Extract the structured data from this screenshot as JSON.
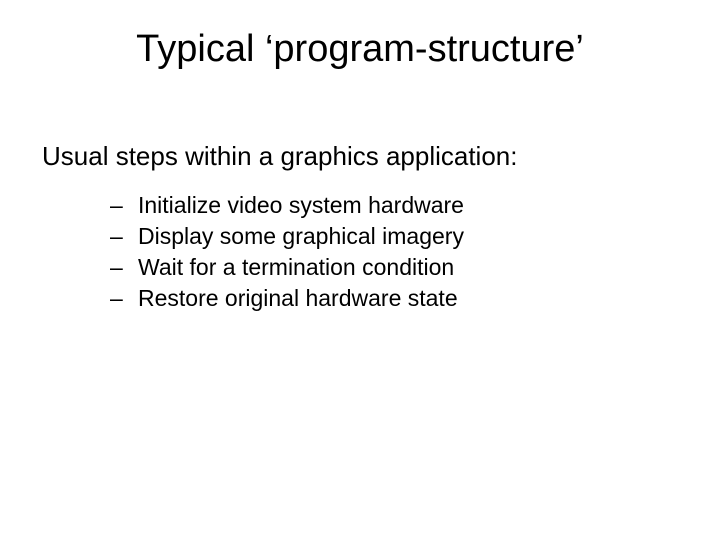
{
  "title": "Typical ‘program-structure’",
  "subtitle": "Usual steps within a graphics application:",
  "bullets": [
    "Initialize video system hardware",
    "Display some graphical imagery",
    "Wait for a termination condition",
    "Restore original hardware state"
  ],
  "dash": "–"
}
